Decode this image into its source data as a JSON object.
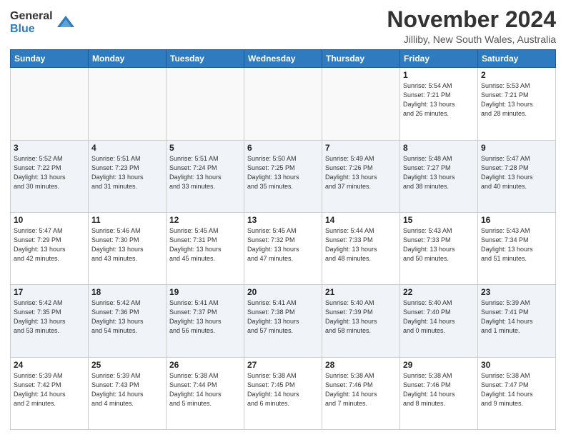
{
  "logo": {
    "general": "General",
    "blue": "Blue"
  },
  "header": {
    "month": "November 2024",
    "location": "Jilliby, New South Wales, Australia"
  },
  "weekdays": [
    "Sunday",
    "Monday",
    "Tuesday",
    "Wednesday",
    "Thursday",
    "Friday",
    "Saturday"
  ],
  "weeks": [
    [
      {
        "day": "",
        "info": ""
      },
      {
        "day": "",
        "info": ""
      },
      {
        "day": "",
        "info": ""
      },
      {
        "day": "",
        "info": ""
      },
      {
        "day": "",
        "info": ""
      },
      {
        "day": "1",
        "info": "Sunrise: 5:54 AM\nSunset: 7:21 PM\nDaylight: 13 hours\nand 26 minutes."
      },
      {
        "day": "2",
        "info": "Sunrise: 5:53 AM\nSunset: 7:21 PM\nDaylight: 13 hours\nand 28 minutes."
      }
    ],
    [
      {
        "day": "3",
        "info": "Sunrise: 5:52 AM\nSunset: 7:22 PM\nDaylight: 13 hours\nand 30 minutes."
      },
      {
        "day": "4",
        "info": "Sunrise: 5:51 AM\nSunset: 7:23 PM\nDaylight: 13 hours\nand 31 minutes."
      },
      {
        "day": "5",
        "info": "Sunrise: 5:51 AM\nSunset: 7:24 PM\nDaylight: 13 hours\nand 33 minutes."
      },
      {
        "day": "6",
        "info": "Sunrise: 5:50 AM\nSunset: 7:25 PM\nDaylight: 13 hours\nand 35 minutes."
      },
      {
        "day": "7",
        "info": "Sunrise: 5:49 AM\nSunset: 7:26 PM\nDaylight: 13 hours\nand 37 minutes."
      },
      {
        "day": "8",
        "info": "Sunrise: 5:48 AM\nSunset: 7:27 PM\nDaylight: 13 hours\nand 38 minutes."
      },
      {
        "day": "9",
        "info": "Sunrise: 5:47 AM\nSunset: 7:28 PM\nDaylight: 13 hours\nand 40 minutes."
      }
    ],
    [
      {
        "day": "10",
        "info": "Sunrise: 5:47 AM\nSunset: 7:29 PM\nDaylight: 13 hours\nand 42 minutes."
      },
      {
        "day": "11",
        "info": "Sunrise: 5:46 AM\nSunset: 7:30 PM\nDaylight: 13 hours\nand 43 minutes."
      },
      {
        "day": "12",
        "info": "Sunrise: 5:45 AM\nSunset: 7:31 PM\nDaylight: 13 hours\nand 45 minutes."
      },
      {
        "day": "13",
        "info": "Sunrise: 5:45 AM\nSunset: 7:32 PM\nDaylight: 13 hours\nand 47 minutes."
      },
      {
        "day": "14",
        "info": "Sunrise: 5:44 AM\nSunset: 7:33 PM\nDaylight: 13 hours\nand 48 minutes."
      },
      {
        "day": "15",
        "info": "Sunrise: 5:43 AM\nSunset: 7:33 PM\nDaylight: 13 hours\nand 50 minutes."
      },
      {
        "day": "16",
        "info": "Sunrise: 5:43 AM\nSunset: 7:34 PM\nDaylight: 13 hours\nand 51 minutes."
      }
    ],
    [
      {
        "day": "17",
        "info": "Sunrise: 5:42 AM\nSunset: 7:35 PM\nDaylight: 13 hours\nand 53 minutes."
      },
      {
        "day": "18",
        "info": "Sunrise: 5:42 AM\nSunset: 7:36 PM\nDaylight: 13 hours\nand 54 minutes."
      },
      {
        "day": "19",
        "info": "Sunrise: 5:41 AM\nSunset: 7:37 PM\nDaylight: 13 hours\nand 56 minutes."
      },
      {
        "day": "20",
        "info": "Sunrise: 5:41 AM\nSunset: 7:38 PM\nDaylight: 13 hours\nand 57 minutes."
      },
      {
        "day": "21",
        "info": "Sunrise: 5:40 AM\nSunset: 7:39 PM\nDaylight: 13 hours\nand 58 minutes."
      },
      {
        "day": "22",
        "info": "Sunrise: 5:40 AM\nSunset: 7:40 PM\nDaylight: 14 hours\nand 0 minutes."
      },
      {
        "day": "23",
        "info": "Sunrise: 5:39 AM\nSunset: 7:41 PM\nDaylight: 14 hours\nand 1 minute."
      }
    ],
    [
      {
        "day": "24",
        "info": "Sunrise: 5:39 AM\nSunset: 7:42 PM\nDaylight: 14 hours\nand 2 minutes."
      },
      {
        "day": "25",
        "info": "Sunrise: 5:39 AM\nSunset: 7:43 PM\nDaylight: 14 hours\nand 4 minutes."
      },
      {
        "day": "26",
        "info": "Sunrise: 5:38 AM\nSunset: 7:44 PM\nDaylight: 14 hours\nand 5 minutes."
      },
      {
        "day": "27",
        "info": "Sunrise: 5:38 AM\nSunset: 7:45 PM\nDaylight: 14 hours\nand 6 minutes."
      },
      {
        "day": "28",
        "info": "Sunrise: 5:38 AM\nSunset: 7:46 PM\nDaylight: 14 hours\nand 7 minutes."
      },
      {
        "day": "29",
        "info": "Sunrise: 5:38 AM\nSunset: 7:46 PM\nDaylight: 14 hours\nand 8 minutes."
      },
      {
        "day": "30",
        "info": "Sunrise: 5:38 AM\nSunset: 7:47 PM\nDaylight: 14 hours\nand 9 minutes."
      }
    ]
  ]
}
